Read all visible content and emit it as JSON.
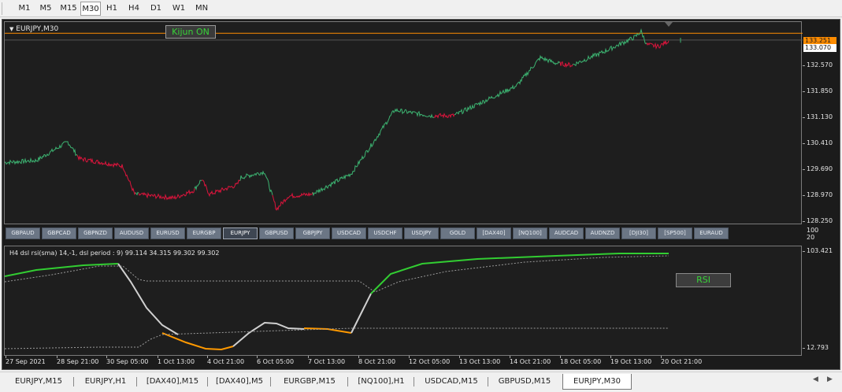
{
  "timeframes": [
    "M1",
    "M5",
    "M15",
    "M30",
    "H1",
    "H4",
    "D1",
    "W1",
    "MN"
  ],
  "active_timeframe": "M30",
  "chart": {
    "symbol_title": "EURJPY,M30",
    "kijun_button": "Kijun ON",
    "price_labels": [
      "133.251",
      "133.070",
      "132.570",
      "131.850",
      "131.130",
      "130.410",
      "129.690",
      "128.970",
      "128.250"
    ],
    "price_min": 128.25,
    "price_max": 133.51,
    "orange_level": 133.251,
    "current_price": 133.07,
    "colors": {
      "bull": "#3cb371",
      "bear": "#dc143c",
      "orange": "#ff8c00",
      "rsi_up": "#32cd32",
      "rsi_down": "#ff9900",
      "rsi_flat": "#d0d0d0"
    }
  },
  "symbol_buttons": [
    "GBPAUD",
    "GBPCAD",
    "GBPNZD",
    "AUDUSD",
    "EURUSD",
    "EURGBP",
    "EURJPY",
    "GBPUSD",
    "GBPJPY",
    "USDCAD",
    "USDCHF",
    "USDJPY",
    "GOLD",
    "[DAX40]",
    "[NQ100]",
    "AUDCAD",
    "AUDNZD",
    "[DJI30]",
    "[SP500]",
    "EURAUD"
  ],
  "active_symbol": "EURJPY",
  "separator_scale": [
    "100",
    "20"
  ],
  "indicator": {
    "title": "H4 dsl rsi(sma) 14,-1, dsl period : 9) 99.114 34.315 99.302 99.302",
    "scale_labels": [
      "103.421",
      "12.793"
    ],
    "rsi_button": "RSI"
  },
  "time_labels": [
    "27 Sep 2021",
    "28 Sep 21:00",
    "30 Sep 05:00",
    "1 Oct 13:00",
    "4 Oct 21:00",
    "6 Oct 05:00",
    "7 Oct 13:00",
    "8 Oct 21:00",
    "12 Oct 05:00",
    "13 Oct 13:00",
    "14 Oct 21:00",
    "18 Oct 05:00",
    "19 Oct 13:00",
    "20 Oct 21:00"
  ],
  "tabs": [
    "EURJPY,M15",
    "EURJPY,H1",
    "[DAX40],M15",
    "[DAX40],M5",
    "EURGBP,M15",
    "[NQ100],H1",
    "USDCAD,M15",
    "GBPUSD,M15",
    "EURJPY,M30"
  ],
  "active_tab": "EURJPY,M30"
}
